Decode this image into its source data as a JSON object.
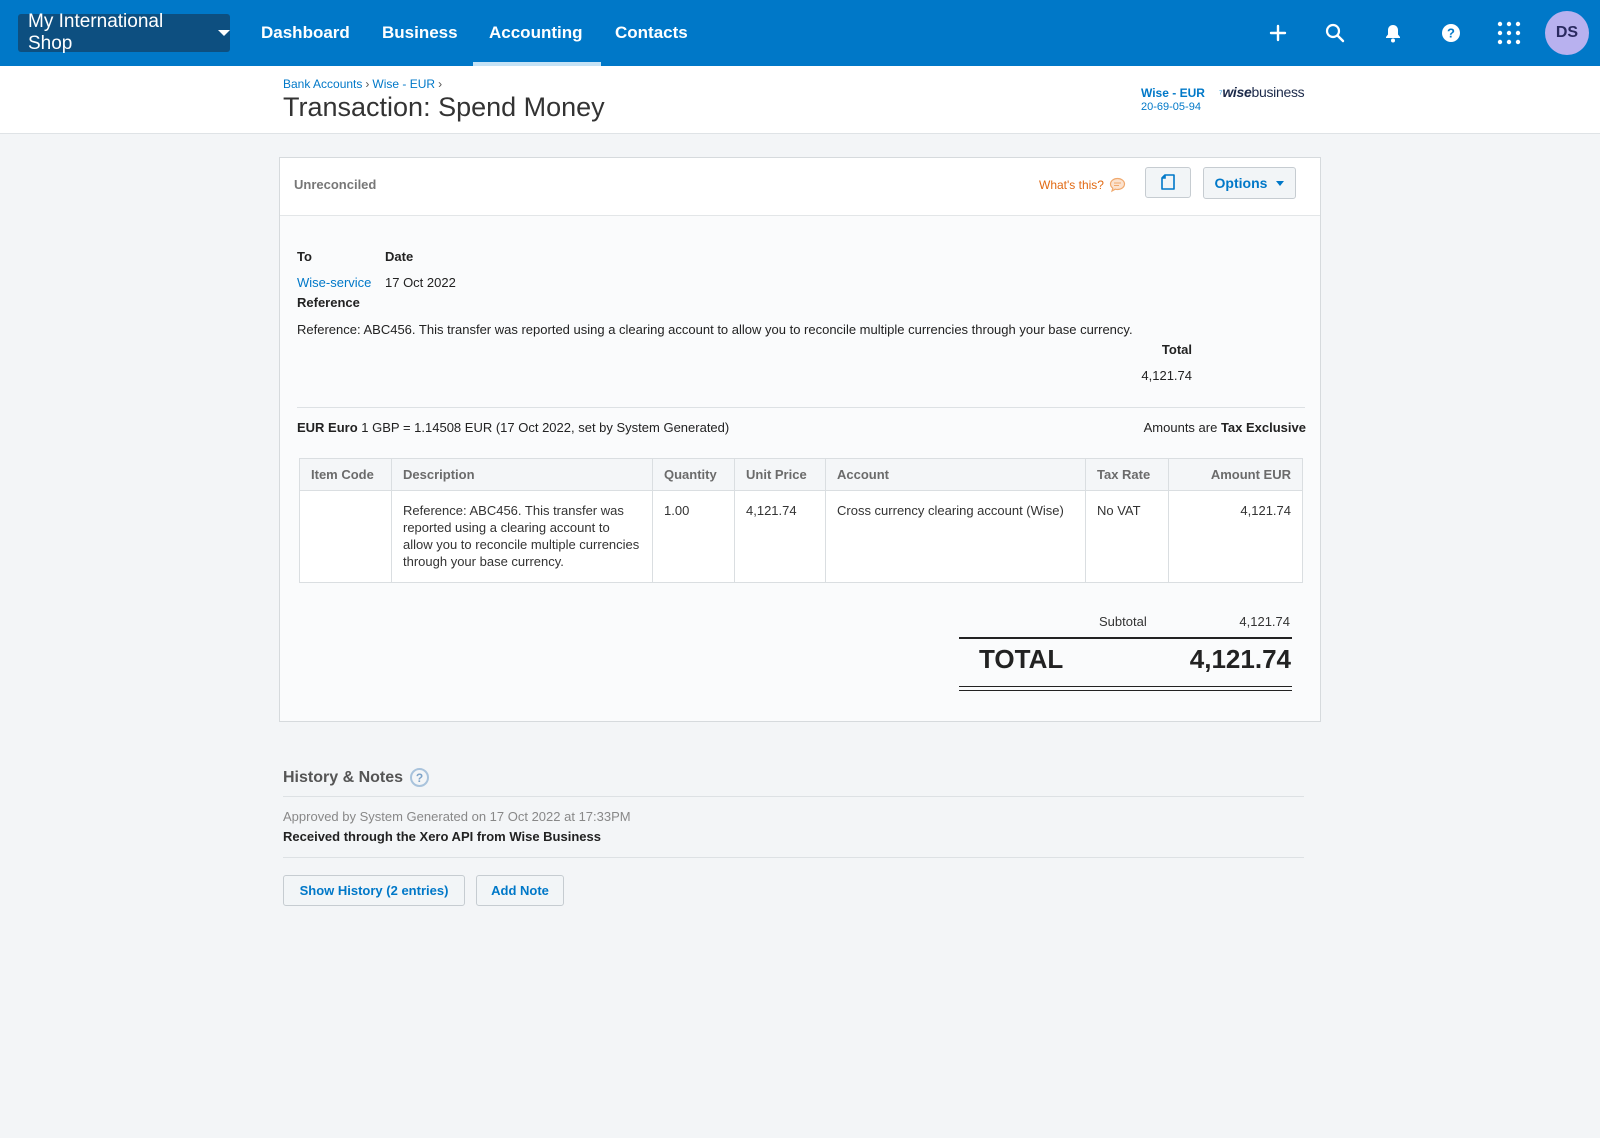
{
  "nav": {
    "org_name": "My International Shop",
    "items": [
      "Dashboard",
      "Business",
      "Accounting",
      "Contacts"
    ],
    "active": "Accounting",
    "avatar_initials": "DS",
    "icons": [
      "plus-icon",
      "search-icon",
      "bell-icon",
      "help-icon",
      "apps-grid-icon"
    ]
  },
  "header": {
    "breadcrumb": [
      "Bank Accounts",
      "Wise - EUR"
    ],
    "title": "Transaction: Spend Money",
    "account_name": "Wise - EUR",
    "account_number": "20-69-05-94",
    "logo_wise": "wise",
    "logo_business": "business"
  },
  "panel": {
    "status": "Unreconciled",
    "whats_this": "What's this?",
    "options_label": "Options",
    "to_label": "To",
    "to_value": "Wise-service",
    "date_label": "Date",
    "date_value": "17 Oct 2022",
    "reference_label": "Reference",
    "reference_value": "Reference: ABC456. This transfer was reported using a clearing account to allow you to reconcile multiple currencies through your base currency.",
    "total_label": "Total",
    "total_value": "4,121.74",
    "currency_code": "EUR Euro",
    "rate_text": "1 GBP = 1.14508 EUR (17 Oct 2022, set by System Generated)",
    "amounts_are": "Amounts are",
    "tax_mode": "Tax Exclusive"
  },
  "table": {
    "headers": [
      "Item Code",
      "Description",
      "Quantity",
      "Unit Price",
      "Account",
      "Tax Rate",
      "Amount EUR"
    ],
    "rows": [
      {
        "item_code": "",
        "description": "Reference: ABC456. This transfer was reported using a clearing account to allow you to reconcile multiple currencies through your base currency.",
        "quantity": "1.00",
        "unit_price": "4,121.74",
        "account": "Cross currency clearing account (Wise)",
        "tax_rate": "No VAT",
        "amount": "4,121.74"
      }
    ]
  },
  "totals": {
    "subtotal_label": "Subtotal",
    "subtotal_value": "4,121.74",
    "total_label": "TOTAL",
    "total_value": "4,121.74"
  },
  "history": {
    "title": "History & Notes",
    "help": "?",
    "meta": "Approved by System Generated on 17 Oct 2022 at 17:33PM",
    "note": "Received through the Xero API from Wise Business",
    "show_history_label": "Show History (2 entries)",
    "add_note_label": "Add Note"
  },
  "colors": {
    "nav_bg": "#0078c8",
    "org_btn_bg": "#0d4f80",
    "link": "#0078c8",
    "whats_this": "#e16a14",
    "avatar_bg": "#b8b1ef"
  }
}
